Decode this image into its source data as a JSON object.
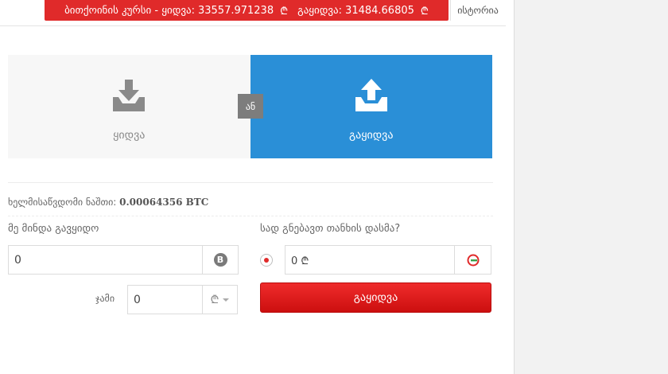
{
  "rate_bar": {
    "prefix": "ბითქოინის კურსი - ყიდვა:",
    "buy_rate": "33557.971238",
    "currency": "₾",
    "separator": "გაყიდვა:",
    "sell_rate": "31484.66805"
  },
  "history_label": "ისტორია",
  "modes": {
    "buy_label": "ყიდვა",
    "sell_label": "გაყიდვა",
    "or_label": "ან",
    "active": "sell"
  },
  "balance": {
    "label": "ხელმისაწვდომი ნაშთი:",
    "value": "0.00064356 BTC"
  },
  "amount": {
    "label": "მე მინდა გავყიდო",
    "value": "0",
    "currency_icon": "bitcoin-icon"
  },
  "total": {
    "label": "ჯამი",
    "value": "0",
    "currency_symbol": "₾"
  },
  "destination": {
    "label": "სად გნებავთ თანხის დასმა?",
    "value": "0 ₾",
    "icon": "lari-wallet-icon"
  },
  "sell_button_label": "გაყიდვა",
  "colors": {
    "accent_blue": "#2a8fd7",
    "accent_red": "#e02a2a"
  }
}
